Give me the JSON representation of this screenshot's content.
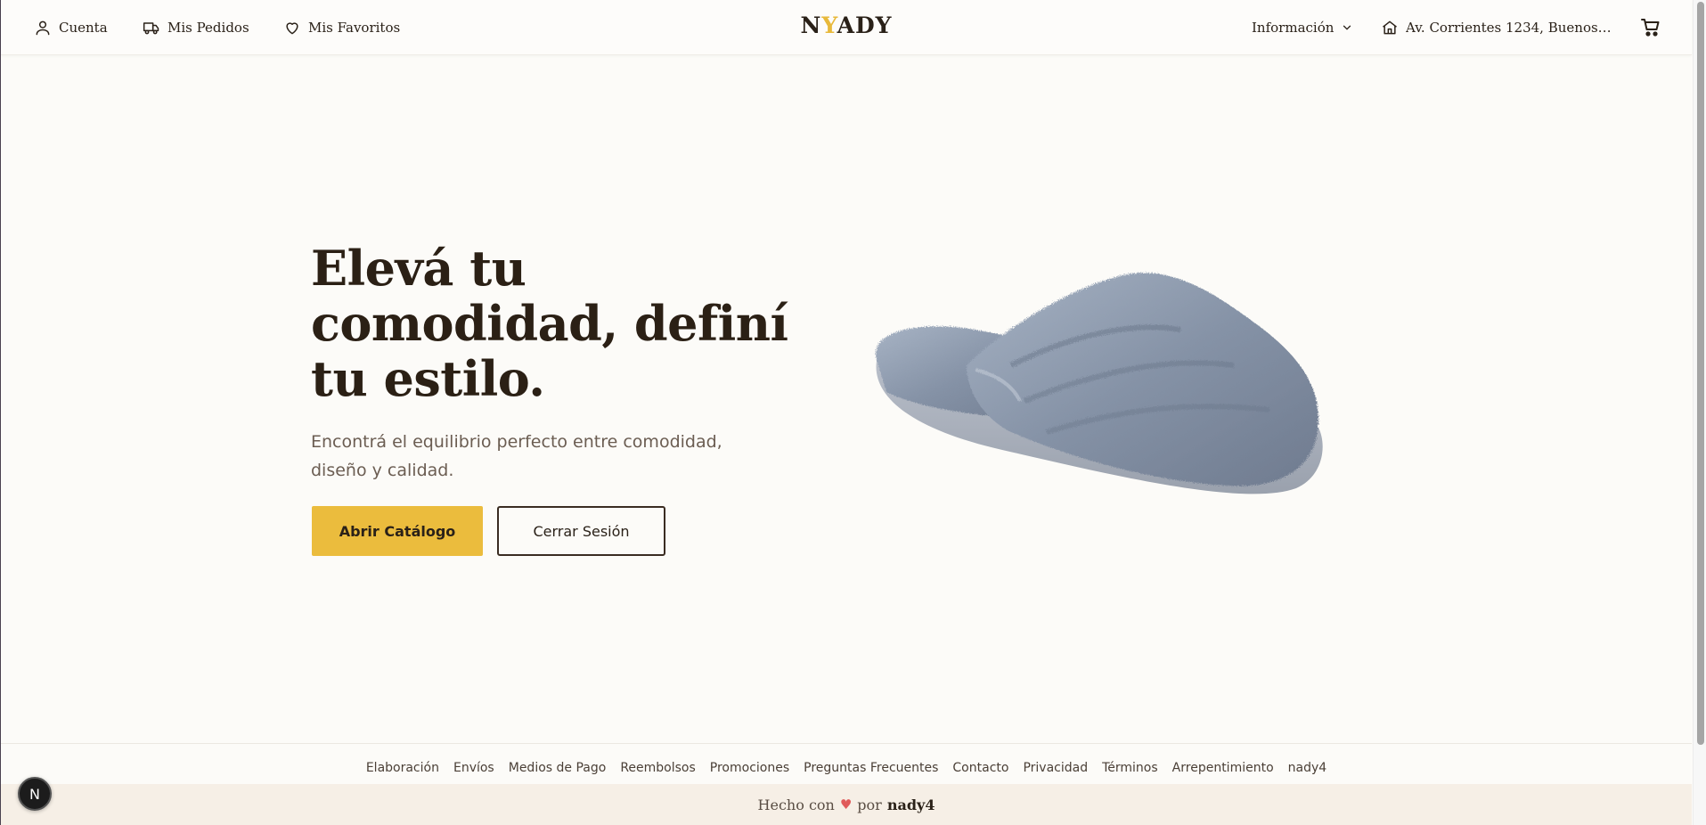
{
  "header": {
    "account_label": "Cuenta",
    "orders_label": "Mis Pedidos",
    "favorites_label": "Mis Favoritos",
    "logo": {
      "part1": "N",
      "accent": "Y",
      "part2": "ADY"
    },
    "info_label": "Información",
    "address_label": "Av. Corrientes 1234, Buenos Air..."
  },
  "hero": {
    "title": "Elevá tu comodidad, definí tu estilo.",
    "subtitle": "Encontrá el equilibrio perfecto entre comodidad, diseño y calidad.",
    "primary_button": "Abrir Catálogo",
    "secondary_button": "Cerrar Sesión",
    "image_icon": "slipper-image"
  },
  "footer": {
    "links": [
      "Elaboración",
      "Envíos",
      "Medios de Pago",
      "Reembolsos",
      "Promociones",
      "Preguntas Frecuentes",
      "Contacto",
      "Privacidad",
      "Términos",
      "Arrepentimiento",
      "nady4"
    ],
    "made_with": "Hecho con",
    "heart": "♥",
    "by": "por",
    "brand": "nady4"
  },
  "fab_label": "N",
  "colors": {
    "accent": "#ebbc3d",
    "background": "#fcfbf8",
    "text": "#2a2118",
    "footer_bar": "#f6efe6"
  }
}
